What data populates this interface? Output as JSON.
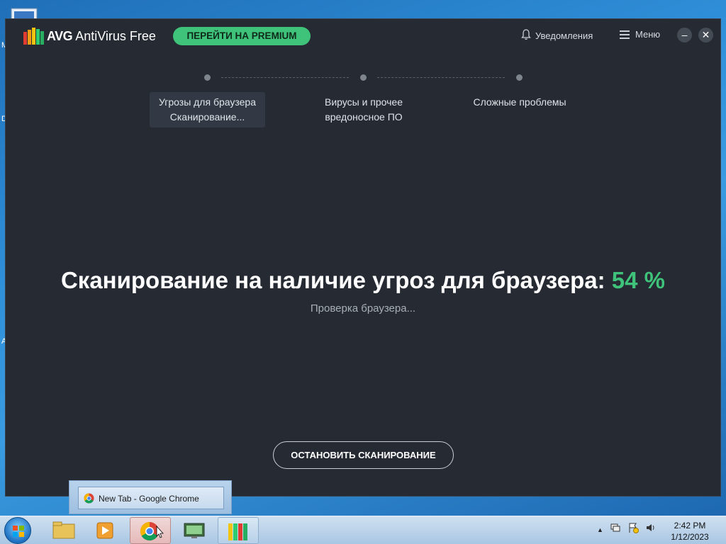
{
  "app": {
    "brand": "AVG",
    "name": "AntiVirus Free",
    "premium_label": "ПЕРЕЙТИ НА PREMIUM",
    "notifications_label": "Уведомления",
    "menu_label": "Меню"
  },
  "steps": [
    {
      "line1": "Угрозы для браузера",
      "line2": "Сканирование..."
    },
    {
      "line1": "Вирусы и прочее",
      "line2": "вредоносное ПО"
    },
    {
      "line1": "Сложные проблемы",
      "line2": ""
    }
  ],
  "scan": {
    "title": "Сканирование на наличие угроз для браузера:",
    "percent": "54 %",
    "progress_value": 54,
    "subtitle": "Проверка браузера...",
    "stop_label": "ОСТАНОВИТЬ СКАНИРОВАНИЕ"
  },
  "taskbar": {
    "preview_title": "New Tab - Google Chrome",
    "time": "2:42 PM",
    "date": "1/12/2023"
  },
  "colors": {
    "accent_green": "#3fc27a",
    "window_bg": "#252a33"
  }
}
